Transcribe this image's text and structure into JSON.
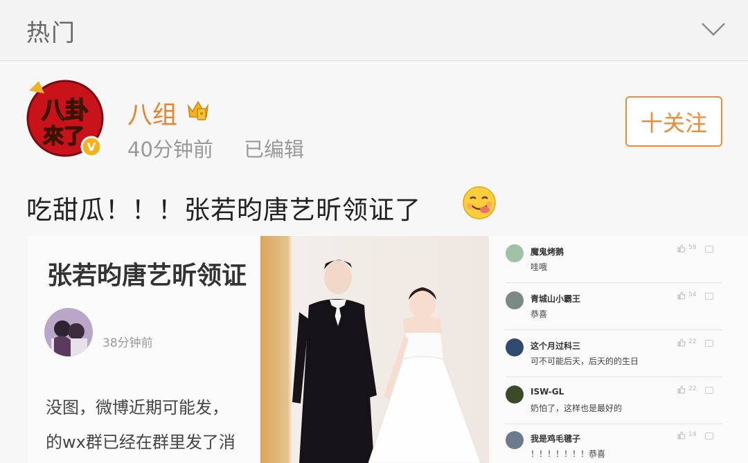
{
  "header": {
    "title": "热门"
  },
  "post": {
    "author": "八组",
    "time": "40分钟前",
    "edited": "已编辑",
    "follow_label": "十关注",
    "text": "吃甜瓜！！！张若昀唐艺昕领证了",
    "avatar_text_top": "八卦",
    "avatar_text_bottom": "來了",
    "avatar_badge": "V"
  },
  "embedded_article": {
    "headline": "张若昀唐艺昕领证",
    "time": "38分钟前",
    "line1": "没图，微博近期可能发，",
    "line2": "的wx群已经在群里发了消"
  },
  "comments": [
    {
      "name": "魔鬼烤鹅",
      "text": "哇哦",
      "likes": "59"
    },
    {
      "name": "青城山小霸王",
      "text": "恭喜",
      "likes": "54"
    },
    {
      "name": "这个月过科三",
      "text": "可不可能后天，后天的的生日",
      "likes": "22"
    },
    {
      "name": "ISW-GL",
      "text": "奶怕了，这样也是最好的",
      "likes": "22"
    },
    {
      "name": "我是鸡毛毽子",
      "text": "！！！！！！！恭喜",
      "likes": "14"
    }
  ],
  "colors": {
    "accent": "#f08a34",
    "author": "#e8842e",
    "avatar_red": "#c8131b"
  },
  "icons": {
    "chevron": "chevron-down-icon",
    "crown": "crown-badge-icon",
    "emoji": "yummy-face-emoji-icon",
    "like": "thumbs-up-icon",
    "reply": "comment-icon"
  }
}
